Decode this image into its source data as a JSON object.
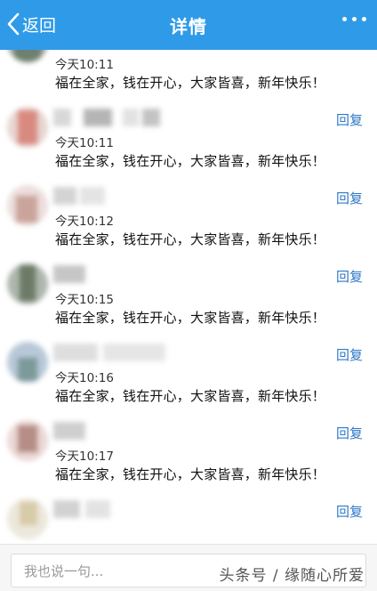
{
  "header": {
    "back_label": "返回",
    "title": "详情",
    "more_icon": "more-dots-icon",
    "background": "#2f9be8"
  },
  "comments": [
    {
      "time": "今天10:11",
      "text": "福在全家，钱在开心，大家皆喜，新年快乐！",
      "reply": ""
    },
    {
      "time": "今天10:11",
      "text": "福在全家，钱在开心，大家皆喜，新年快乐！",
      "reply": "回复"
    },
    {
      "time": "今天10:12",
      "text": "福在全家，钱在开心，大家皆喜，新年快乐！",
      "reply": "回复"
    },
    {
      "time": "今天10:15",
      "text": "福在全家，钱在开心，大家皆喜，新年快乐！",
      "reply": "回复"
    },
    {
      "time": "今天10:16",
      "text": "福在全家，钱在开心，大家皆喜，新年快乐！",
      "reply": "回复"
    },
    {
      "time": "今天10:17",
      "text": "福在全家，钱在开心，大家皆喜，新年快乐！",
      "reply": "回复"
    },
    {
      "time": "",
      "text": "",
      "reply": "回复"
    }
  ],
  "bottom": {
    "placeholder": "我也说一句...",
    "watermark": "头条号 / 缘随心所爱"
  },
  "colors": {
    "reply": "#2f78c6",
    "time": "#333333",
    "text": "#111111"
  }
}
